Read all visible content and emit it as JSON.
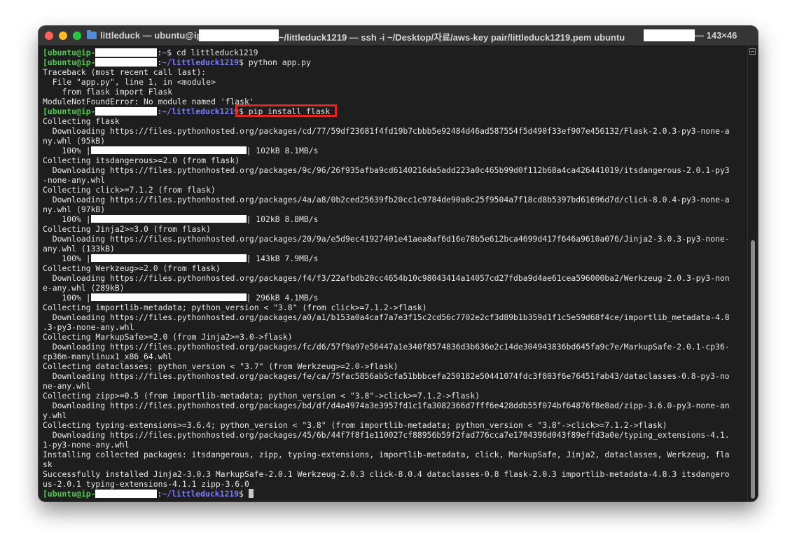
{
  "window": {
    "title_prefix": "littleduck — ubuntu@ip",
    "title_middle": "~/littleduck1219 — ssh -i ~/Desktop/자료/aws-key pair/littleduck1219.pem ubuntu",
    "title_suffix": "— 143×46"
  },
  "prompts": {
    "user_host": "ubuntu@ip-",
    "home_path": "~",
    "project_path": "~/littleduck1219"
  },
  "terminal": {
    "cmd_cd": "cd littleduck1219",
    "cmd_python": "python app.py",
    "tb1": "Traceback (most recent call last):",
    "tb2": "  File \"app.py\", line 1, in <module>",
    "tb3": "    from flask import Flask",
    "tb4": "ModuleNotFoundError: No module named 'flask'",
    "cmd_pip": "pip install flask",
    "o01": "Collecting flask",
    "o02": "  Downloading https://files.pythonhosted.org/packages/cd/77/59df23681f4fd19b7cbbb5e92484d46ad587554f5d490f33ef907e456132/Flask-2.0.3-py3-none-a",
    "o03": "ny.whl (95kB)",
    "p1_pre": "    100% |",
    "p1_post": "| 102kB 8.1MB/s",
    "o05": "Collecting itsdangerous>=2.0 (from flask)",
    "o06": "  Downloading https://files.pythonhosted.org/packages/9c/96/26f935afba9cd6140216da5add223a0c465b99d0f112b68a4ca426441019/itsdangerous-2.0.1-py3",
    "o07": "-none-any.whl",
    "o08": "Collecting click>=7.1.2 (from flask)",
    "o09": "  Downloading https://files.pythonhosted.org/packages/4a/a8/0b2ced25639fb20cc1c9784de90a8c25f9504a7f18cd8b5397bd61696d7d/click-8.0.4-py3-none-a",
    "o10": "ny.whl (97kB)",
    "p2_pre": "    100% |",
    "p2_post": "| 102kB 8.8MB/s",
    "o12": "Collecting Jinja2>=3.0 (from flask)",
    "o13": "  Downloading https://files.pythonhosted.org/packages/20/9a/e5d9ec41927401e41aea8af6d16e78b5e612bca4699d417f646a9610a076/Jinja2-3.0.3-py3-none-",
    "o14": "any.whl (133kB)",
    "p3_pre": "    100% |",
    "p3_post": "| 143kB 7.9MB/s",
    "o16": "Collecting Werkzeug>=2.0 (from flask)",
    "o17": "  Downloading https://files.pythonhosted.org/packages/f4/f3/22afbdb20cc4654b10c98043414a14057cd27fdba9d4ae61cea596000ba2/Werkzeug-2.0.3-py3-non",
    "o18": "e-any.whl (289kB)",
    "p4_pre": "    100% |",
    "p4_post": "| 296kB 4.1MB/s",
    "o20": "Collecting importlib-metadata; python_version < \"3.8\" (from click>=7.1.2->flask)",
    "o21": "  Downloading https://files.pythonhosted.org/packages/a0/a1/b153a0a4caf7a7e3f15c2cd56c7702e2cf3d89b1b359d1f1c5e59d68f4ce/importlib_metadata-4.8",
    "o22": ".3-py3-none-any.whl",
    "o23": "Collecting MarkupSafe>=2.0 (from Jinja2>=3.0->flask)",
    "o24": "  Downloading https://files.pythonhosted.org/packages/fc/d6/57f9a97e56447a1e340f8574836d3b636e2c14de304943836bd645fa9c7e/MarkupSafe-2.0.1-cp36-",
    "o25": "cp36m-manylinux1_x86_64.whl",
    "o26": "Collecting dataclasses; python_version < \"3.7\" (from Werkzeug>=2.0->flask)",
    "o27": "  Downloading https://files.pythonhosted.org/packages/fe/ca/75fac5856ab5cfa51bbbcefa250182e50441074fdc3f803f6e76451fab43/dataclasses-0.8-py3-no",
    "o28": "ne-any.whl",
    "o29": "Collecting zipp>=0.5 (from importlib-metadata; python_version < \"3.8\"->click>=7.1.2->flask)",
    "o30": "  Downloading https://files.pythonhosted.org/packages/bd/df/d4a4974a3e3957fd1c1fa3082366d7fff6e428ddb55f074bf64876f8e8ad/zipp-3.6.0-py3-none-an",
    "o31": "y.whl",
    "o32": "Collecting typing-extensions>=3.6.4; python_version < \"3.8\" (from importlib-metadata; python_version < \"3.8\"->click>=7.1.2->flask)",
    "o33": "  Downloading https://files.pythonhosted.org/packages/45/6b/44f7f8f1e110027cf88956b59f2fad776cca7e1704396d043f89effd3a0e/typing_extensions-4.1.",
    "o34": "1-py3-none-any.whl",
    "o35": "Installing collected packages: itsdangerous, zipp, typing-extensions, importlib-metadata, click, MarkupSafe, Jinja2, dataclasses, Werkzeug, fla",
    "o36": "sk",
    "o37": "Successfully installed Jinja2-3.0.3 MarkupSafe-2.0.1 Werkzeug-2.0.3 click-8.0.4 dataclasses-0.8 flask-2.0.3 importlib-metadata-4.8.3 itsdangero",
    "o38": "us-2.0.1 typing-extensions-4.1.1 zipp-3.6.0"
  },
  "colors": {
    "prompt_user": "#4ec94e",
    "prompt_path": "#7a7aff",
    "highlight": "#e5251b",
    "background": "#1e1e1e"
  },
  "icons": [
    "close-icon",
    "minimize-icon",
    "maximize-icon",
    "folder-icon",
    "split-pane-icon"
  ]
}
